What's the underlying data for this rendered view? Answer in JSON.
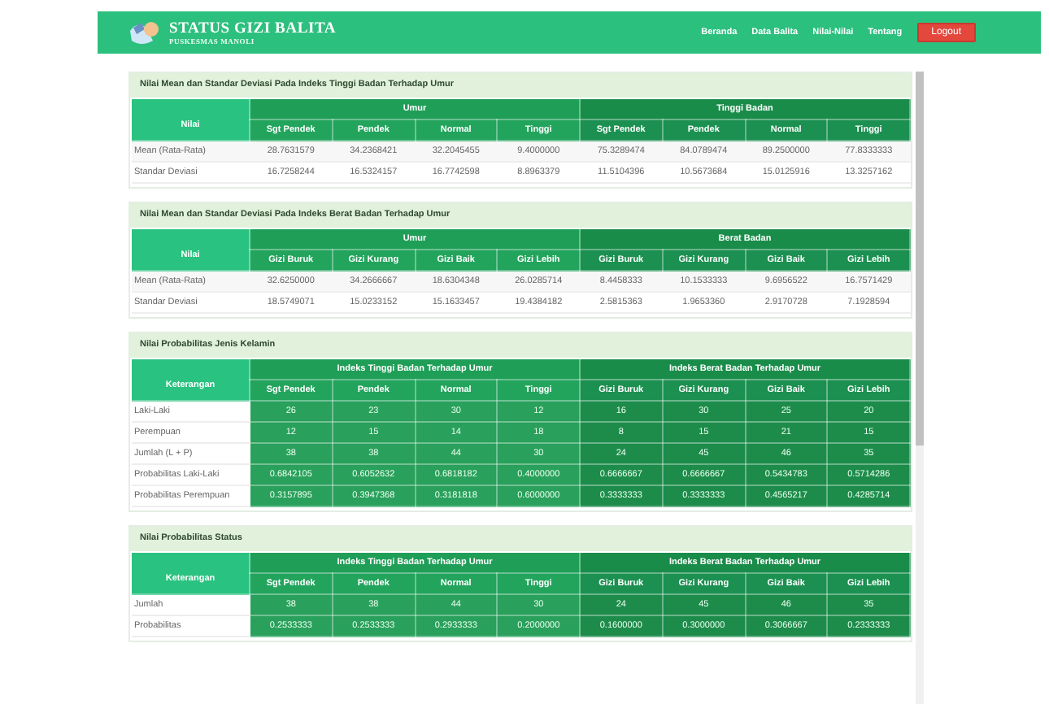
{
  "header": {
    "title": "STATUS GIZI BALITA",
    "subtitle": "PUSKESMAS MANOLI",
    "nav": [
      "Beranda",
      "Data Balita",
      "Nilai-Nilai",
      "Tentang"
    ],
    "logout": "Logout"
  },
  "sections": [
    {
      "kind": "plain",
      "title": "Nilai Mean dan Standar Deviasi Pada Indeks Tinggi Badan Terhadap Umur",
      "corner": "Nilai",
      "groups": [
        {
          "label": "Umur",
          "columns": [
            "Sgt Pendek",
            "Pendek",
            "Normal",
            "Tinggi"
          ]
        },
        {
          "label": "Tinggi Badan",
          "columns": [
            "Sgt Pendek",
            "Pendek",
            "Normal",
            "Tinggi"
          ]
        }
      ],
      "rows": [
        {
          "label": "Mean (Rata-Rata)",
          "values": [
            "28.7631579",
            "34.2368421",
            "32.2045455",
            "9.4000000",
            "75.3289474",
            "84.0789474",
            "89.2500000",
            "77.8333333"
          ]
        },
        {
          "label": "Standar Deviasi",
          "values": [
            "16.7258244",
            "16.5324157",
            "16.7742598",
            "8.8963379",
            "11.5104396",
            "10.5673684",
            "15.0125916",
            "13.3257162"
          ]
        }
      ]
    },
    {
      "kind": "plain",
      "title": "Nilai Mean dan Standar Deviasi Pada Indeks Berat Badan Terhadap Umur",
      "corner": "Nilai",
      "groups": [
        {
          "label": "Umur",
          "columns": [
            "Gizi Buruk",
            "Gizi Kurang",
            "Gizi Baik",
            "Gizi Lebih"
          ]
        },
        {
          "label": "Berat Badan",
          "columns": [
            "Gizi Buruk",
            "Gizi Kurang",
            "Gizi Baik",
            "Gizi Lebih"
          ]
        }
      ],
      "rows": [
        {
          "label": "Mean (Rata-Rata)",
          "values": [
            "32.6250000",
            "34.2666667",
            "18.6304348",
            "26.0285714",
            "8.4458333",
            "10.1533333",
            "9.6956522",
            "16.7571429"
          ]
        },
        {
          "label": "Standar Deviasi",
          "values": [
            "18.5749071",
            "15.0233152",
            "15.1633457",
            "19.4384182",
            "2.5815363",
            "1.9653360",
            "2.9170728",
            "7.1928594"
          ]
        }
      ]
    },
    {
      "kind": "filled",
      "title": "Nilai Probabilitas Jenis Kelamin",
      "corner": "Keterangan",
      "groups": [
        {
          "label": "Indeks Tinggi Badan Terhadap Umur",
          "columns": [
            "Sgt Pendek",
            "Pendek",
            "Normal",
            "Tinggi"
          ]
        },
        {
          "label": "Indeks Berat Badan Terhadap Umur",
          "columns": [
            "Gizi Buruk",
            "Gizi Kurang",
            "Gizi Baik",
            "Gizi Lebih"
          ]
        }
      ],
      "rows": [
        {
          "label": "Laki-Laki",
          "values": [
            "26",
            "23",
            "30",
            "12",
            "16",
            "30",
            "25",
            "20"
          ]
        },
        {
          "label": "Perempuan",
          "values": [
            "12",
            "15",
            "14",
            "18",
            "8",
            "15",
            "21",
            "15"
          ]
        },
        {
          "label": "Jumlah (L + P)",
          "values": [
            "38",
            "38",
            "44",
            "30",
            "24",
            "45",
            "46",
            "35"
          ]
        },
        {
          "label": "Probabilitas Laki-Laki",
          "values": [
            "0.6842105",
            "0.6052632",
            "0.6818182",
            "0.4000000",
            "0.6666667",
            "0.6666667",
            "0.5434783",
            "0.5714286"
          ]
        },
        {
          "label": "Probabilitas Perempuan",
          "values": [
            "0.3157895",
            "0.3947368",
            "0.3181818",
            "0.6000000",
            "0.3333333",
            "0.3333333",
            "0.4565217",
            "0.4285714"
          ]
        }
      ]
    },
    {
      "kind": "filled",
      "title": "Nilai Probabilitas Status",
      "corner": "Keterangan",
      "groups": [
        {
          "label": "Indeks Tinggi Badan Terhadap Umur",
          "columns": [
            "Sgt Pendek",
            "Pendek",
            "Normal",
            "Tinggi"
          ]
        },
        {
          "label": "Indeks Berat Badan Terhadap Umur",
          "columns": [
            "Gizi Buruk",
            "Gizi Kurang",
            "Gizi Baik",
            "Gizi Lebih"
          ]
        }
      ],
      "rows": [
        {
          "label": "Jumlah",
          "values": [
            "38",
            "38",
            "44",
            "30",
            "24",
            "45",
            "46",
            "35"
          ]
        },
        {
          "label": "Probabilitas",
          "values": [
            "0.2533333",
            "0.2533333",
            "0.2933333",
            "0.2000000",
            "0.1600000",
            "0.3000000",
            "0.3066667",
            "0.2333333"
          ]
        }
      ]
    }
  ]
}
